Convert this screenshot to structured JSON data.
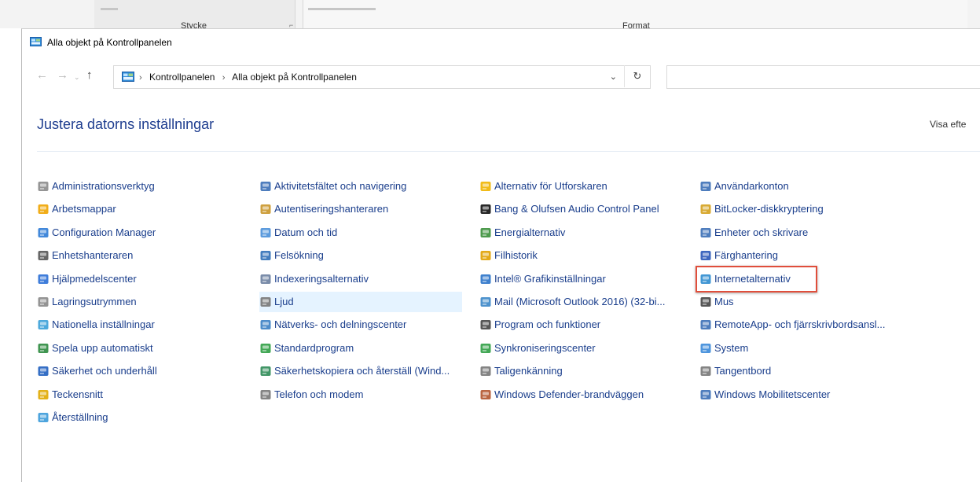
{
  "background": {
    "left_label": "Stycke",
    "right_label": "Format"
  },
  "window": {
    "title": "Alla objekt på Kontrollpanelen"
  },
  "nav": {
    "back": "←",
    "forward": "→",
    "recent": "⌄",
    "up": "↑",
    "breadcrumbs": [
      "Kontrollpanelen",
      "Alla objekt på Kontrollpanelen"
    ],
    "refresh": "↻",
    "dropdown": "⌄"
  },
  "header": {
    "title": "Justera datorns inställningar",
    "view_by": "Visa efte"
  },
  "columns": [
    [
      {
        "label": "Administrationsverktyg",
        "icon": "tools-icon",
        "color": "#8a8a8a"
      },
      {
        "label": "Arbetsmappar",
        "icon": "work-folders-icon",
        "color": "#f0a400"
      },
      {
        "label": "Configuration Manager",
        "icon": "configuration-manager-icon",
        "color": "#2e7bd6"
      },
      {
        "label": "Enhetshanteraren",
        "icon": "device-manager-icon",
        "color": "#555"
      },
      {
        "label": "Hjälpmedelscenter",
        "icon": "accessibility-icon",
        "color": "#2a6fd6"
      },
      {
        "label": "Lagringsutrymmen",
        "icon": "storage-icon",
        "color": "#888"
      },
      {
        "label": "Nationella inställningar",
        "icon": "region-icon",
        "color": "#3aa0d8"
      },
      {
        "label": "Spela upp automatiskt",
        "icon": "autoplay-icon",
        "color": "#2b8a3e"
      },
      {
        "label": "Säkerhet och underhåll",
        "icon": "flag-icon",
        "color": "#1f5fbf"
      },
      {
        "label": "Teckensnitt",
        "icon": "fonts-icon",
        "color": "#e0a800"
      },
      {
        "label": "Återställning",
        "icon": "recovery-icon",
        "color": "#3a9ad9"
      }
    ],
    [
      {
        "label": "Aktivitetsfältet och navigering",
        "icon": "taskbar-icon",
        "color": "#3b6fb6"
      },
      {
        "label": "Autentiseringshanteraren",
        "icon": "credential-icon",
        "color": "#c9962a"
      },
      {
        "label": "Datum och tid",
        "icon": "clock-icon",
        "color": "#4a90d9"
      },
      {
        "label": "Felsökning",
        "icon": "troubleshooting-icon",
        "color": "#2f6fb7"
      },
      {
        "label": "Indexeringsalternativ",
        "icon": "indexing-icon",
        "color": "#6b7fa0"
      },
      {
        "label": "Ljud",
        "icon": "speaker-icon",
        "color": "#777"
      },
      {
        "label": "Nätverks- och delningscenter",
        "icon": "network-icon",
        "color": "#3b7fc4"
      },
      {
        "label": "Standardprogram",
        "icon": "default-programs-icon",
        "color": "#2f9e44"
      },
      {
        "label": "Säkerhetskopiera och återställ (Wind...",
        "icon": "backup-icon",
        "color": "#2e8b57"
      },
      {
        "label": "Telefon och modem",
        "icon": "phone-icon",
        "color": "#777"
      }
    ],
    [
      {
        "label": "Alternativ för Utforskaren",
        "icon": "folder-options-icon",
        "color": "#f0b400"
      },
      {
        "label": "Bang & Olufsen Audio Control Panel",
        "icon": "bang-olufsen-icon",
        "color": "#111"
      },
      {
        "label": "Energialternativ",
        "icon": "power-icon",
        "color": "#3a8f3a"
      },
      {
        "label": "Filhistorik",
        "icon": "file-history-icon",
        "color": "#e0a000"
      },
      {
        "label": "Intel® Grafikinställningar",
        "icon": "intel-graphics-icon",
        "color": "#2a73c9"
      },
      {
        "label": "Mail (Microsoft Outlook 2016) (32-bi...",
        "icon": "mail-icon",
        "color": "#3a86c8"
      },
      {
        "label": "Program och funktioner",
        "icon": "programs-icon",
        "color": "#444"
      },
      {
        "label": "Synkroniseringscenter",
        "icon": "sync-icon",
        "color": "#2f9e44"
      },
      {
        "label": "Taligenkänning",
        "icon": "microphone-icon",
        "color": "#777"
      },
      {
        "label": "Windows Defender-brandväggen",
        "icon": "firewall-icon",
        "color": "#b3542e"
      }
    ],
    [
      {
        "label": "Användarkonton",
        "icon": "users-icon",
        "color": "#3b6fb6"
      },
      {
        "label": "BitLocker-diskkryptering",
        "icon": "bitlocker-icon",
        "color": "#d4a11e"
      },
      {
        "label": "Enheter och skrivare",
        "icon": "printer-icon",
        "color": "#3b6fb6"
      },
      {
        "label": "Färghantering",
        "icon": "color-management-icon",
        "color": "#2956b8"
      },
      {
        "label": "Internetalternativ",
        "icon": "internet-options-icon",
        "color": "#2d8ccf"
      },
      {
        "label": "Mus",
        "icon": "mouse-icon",
        "color": "#444"
      },
      {
        "label": "RemoteApp- och fjärrskrivbordsansl...",
        "icon": "remoteapp-icon",
        "color": "#3b6fb6"
      },
      {
        "label": "System",
        "icon": "system-icon",
        "color": "#3b8ad9"
      },
      {
        "label": "Tangentbord",
        "icon": "keyboard-icon",
        "color": "#777"
      },
      {
        "label": "Windows Mobilitetscenter",
        "icon": "mobility-center-icon",
        "color": "#3b6fb6"
      }
    ]
  ],
  "highlighted_item": "Internetalternativ",
  "hovered_item": "Ljud",
  "colors": {
    "link": "#1a3e8c",
    "heading": "#1e3d8f",
    "highlight": "#e04e3b",
    "hover": "#e5f3ff"
  }
}
